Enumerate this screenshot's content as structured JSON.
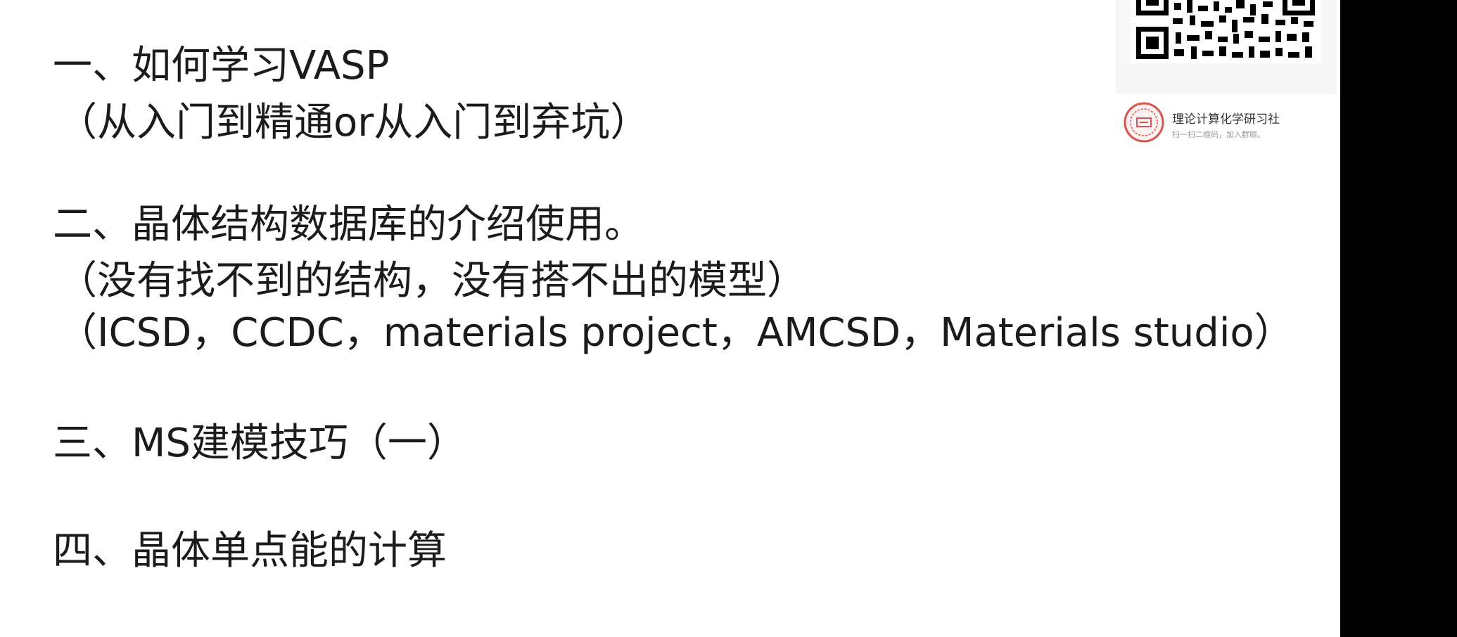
{
  "slide": {
    "lines": [
      "一、如何学习VASP",
      "（从入门到精通or从入门到弃坑）",
      "二、晶体结构数据库的介绍使用。",
      "（没有找不到的结构，没有搭不出的模型）",
      "（ICSD，CCDC，materials project，AMCSD，Materials studio）",
      "三、MS建模技巧（一）",
      "四、晶体单点能的计算"
    ]
  },
  "watermark": {
    "title": "理论计算化学研习社",
    "subtitle": "扫一扫二维码，加入群聊。",
    "logo_icon": "seal-logo-icon",
    "qr_icon": "qr-code-icon"
  },
  "colors": {
    "text": "#1b1b1b",
    "logo": "#d9534f",
    "background": "#ffffff",
    "side_bar": "#000000"
  }
}
